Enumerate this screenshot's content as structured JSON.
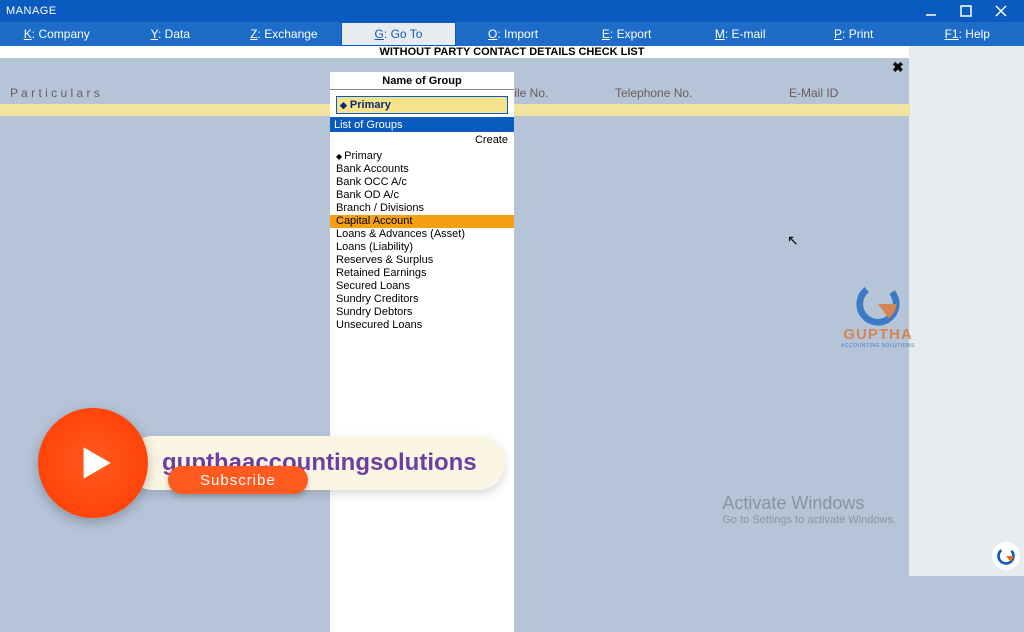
{
  "titlebar": {
    "title": "MANAGE"
  },
  "menu": {
    "k": "Company",
    "y": "Data",
    "z": "Exchange",
    "g": "Go To",
    "o": "Import",
    "e": "Export",
    "m": "E-mail",
    "p": "Print",
    "f1": "Help"
  },
  "page_header": "WITHOUT PARTY CONTACT DETAILS CHECK LIST",
  "columns": {
    "particulars": "P a r t i c u l a r s",
    "mobile": "Mobile No.",
    "telephone": "Telephone No.",
    "email": "E-Mail ID"
  },
  "popup": {
    "caption": "Name of Group",
    "field_value": "Primary",
    "list_header": "List of Groups",
    "create": "Create",
    "items": [
      "Primary",
      "Bank Accounts",
      "Bank OCC A/c",
      "Bank OD A/c",
      "Branch / Divisions",
      "Capital Account",
      "Loans & Advances (Asset)",
      "Loans (Liability)",
      "Reserves & Surplus",
      "Retained Earnings",
      "Secured Loans",
      "Sundry Creditors",
      "Sundry Debtors",
      "Unsecured Loans"
    ],
    "selected_index": 5
  },
  "logo": {
    "brand": "GUPTHA",
    "sub": "ACCOUNTING SOLUTIONS"
  },
  "activate": {
    "line1": "Activate Windows",
    "line2": "Go to Settings to activate Windows."
  },
  "overlay": {
    "channel": "gupthaaccountingsolutions",
    "subscribe": "Subscribe"
  }
}
